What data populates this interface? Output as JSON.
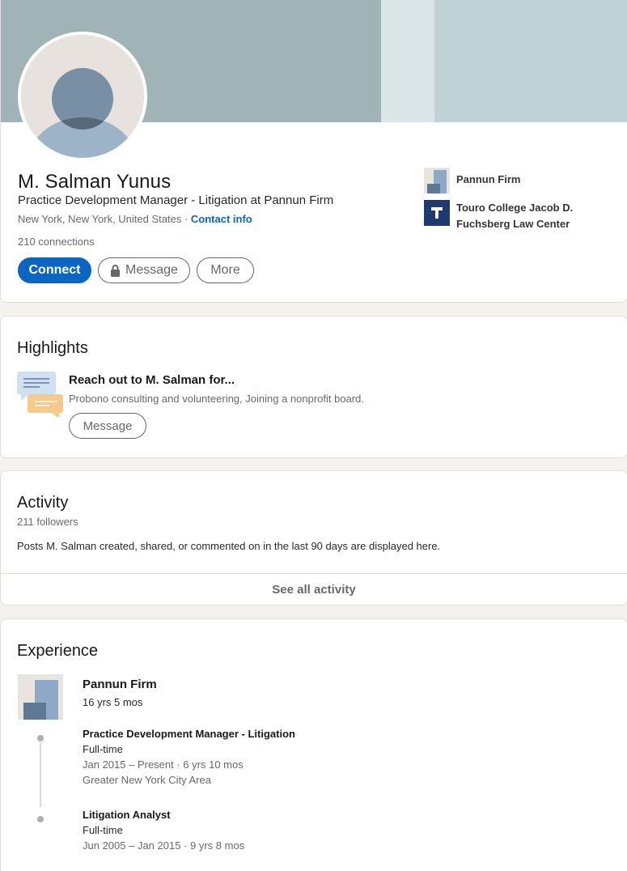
{
  "profile": {
    "name": "M. Salman Yunus",
    "headline": "Practice Development Manager - Litigation at Pannun Firm",
    "location": "New York, New York, United States",
    "separator": " · ",
    "contact_info": "Contact info",
    "connections": "210 connections",
    "buttons": {
      "connect": "Connect",
      "message": "Message",
      "more": "More"
    },
    "side": [
      {
        "icon": "company-logo-icon",
        "label": "Pannun Firm"
      },
      {
        "icon": "school-logo-icon",
        "label_line1": "Touro College Jacob D.",
        "label_line2": "Fuchsberg Law Center"
      }
    ]
  },
  "highlights": {
    "title": "Highlights",
    "item_title": "Reach out to M. Salman for...",
    "item_subtitle": "Probono consulting and volunteering, Joining a nonprofit board.",
    "button": "Message"
  },
  "activity": {
    "title": "Activity",
    "followers": "211 followers",
    "description": "Posts M. Salman created, shared, or commented on in the last 90 days are displayed here.",
    "see_all": "See all activity"
  },
  "experience": {
    "title": "Experience",
    "company": "Pannun Firm",
    "total_duration": "16 yrs 5 mos",
    "roles": [
      {
        "title": "Practice Development Manager - Litigation",
        "type": "Full-time",
        "dates": "Jan 2015 – Present · 6 yrs 10 mos",
        "location": "Greater New York City Area"
      },
      {
        "title": "Litigation Analyst",
        "type": "Full-time",
        "dates": "Jun 2005 – Jan 2015 · 9 yrs 8 mos"
      }
    ]
  },
  "colors": {
    "accent": "#0a66c2",
    "banner": "#a0b4b7",
    "page_background": "#f3f2ef"
  }
}
